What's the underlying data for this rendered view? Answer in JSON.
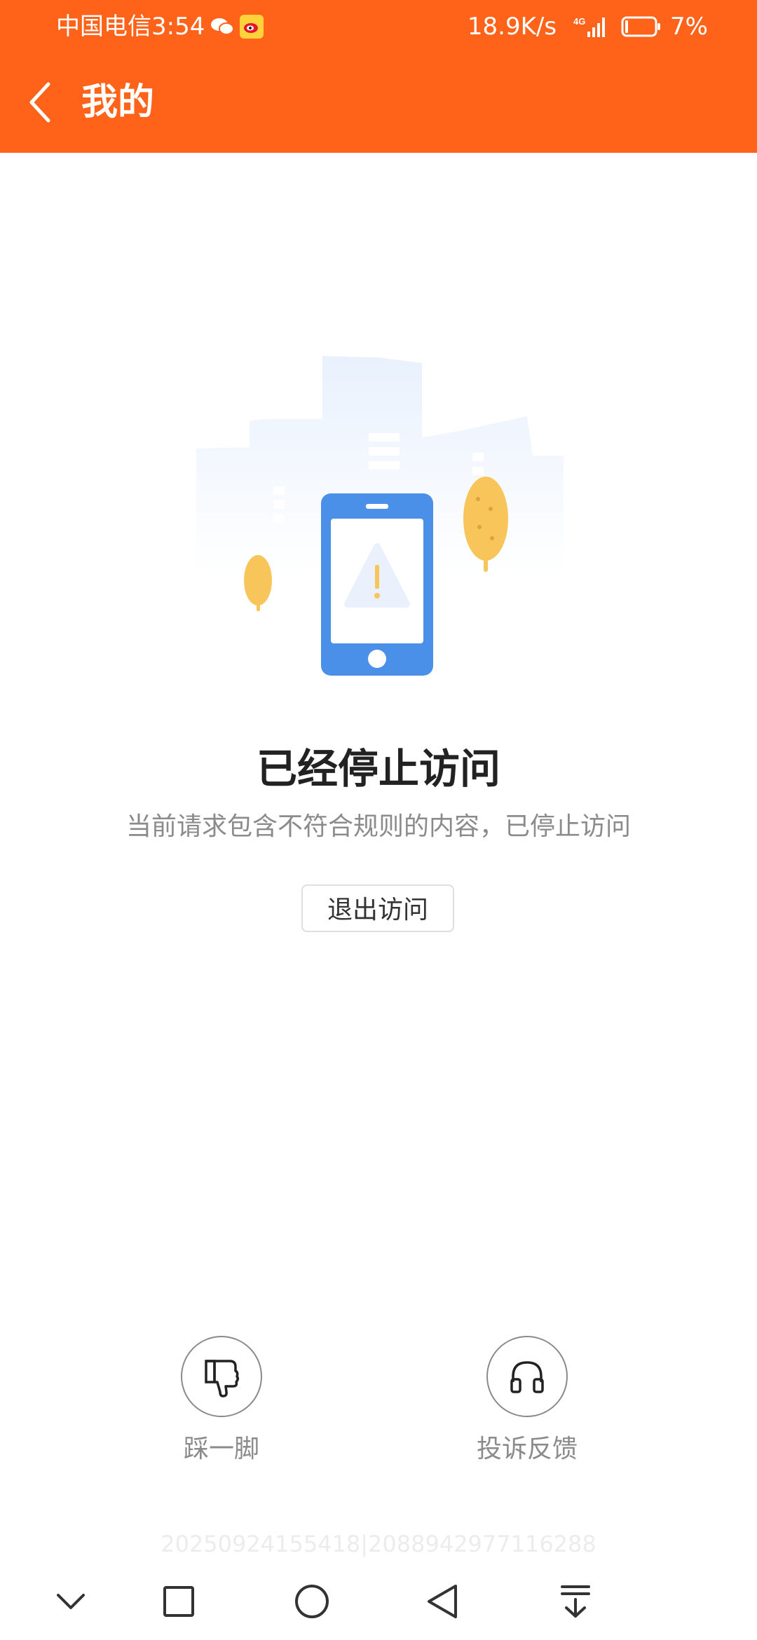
{
  "status_bar": {
    "carrier_time": "中国电信3:54",
    "network_speed": "18.9K/s",
    "signal_label": "4G",
    "battery": "7%"
  },
  "header": {
    "title": "我的"
  },
  "error": {
    "title": "已经停止访问",
    "message": "当前请求包含不符合规则的内容，已停止访问",
    "exit_button": "退出访问"
  },
  "actions": [
    {
      "label": "踩一脚",
      "icon": "thumbs-down-icon"
    },
    {
      "label": "投诉反馈",
      "icon": "headphones-icon"
    }
  ],
  "trace_id": "20250924155418|2088942977116288",
  "colors": {
    "header_bg": "#ff6319",
    "phone_blue": "#4a8fe8",
    "tree_yellow": "#f8c55a"
  },
  "nav_icons": [
    "chevron-down-icon",
    "square-icon",
    "home-circle-icon",
    "back-triangle-icon",
    "download-icon"
  ]
}
